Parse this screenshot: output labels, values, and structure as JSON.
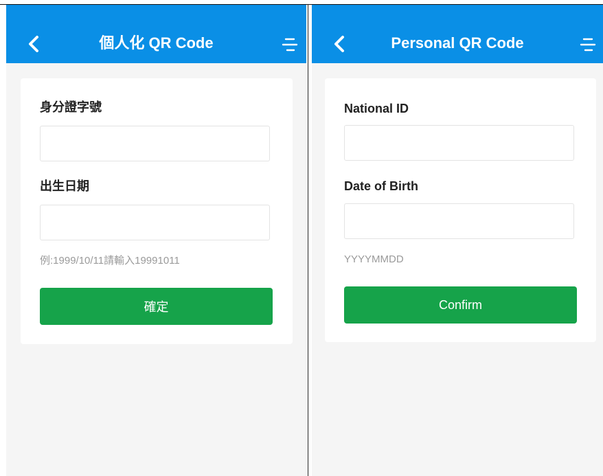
{
  "colors": {
    "header": "#0a8fe6",
    "background": "#f5f5f5",
    "card": "#ffffff",
    "button": "#16a34a",
    "hint": "#9a9a9a"
  },
  "icons": {
    "back": "chevron-left-icon",
    "menu": "menu-icon"
  },
  "left_screen": {
    "title": "個人化 QR Code",
    "id_label": "身分證字號",
    "id_value": "",
    "dob_label": "出生日期",
    "dob_value": "",
    "dob_hint": "例:1999/10/11請輸入19991011",
    "confirm_label": "確定"
  },
  "right_screen": {
    "title": "Personal QR Code",
    "id_label": "National ID",
    "id_value": "",
    "dob_label": "Date of Birth",
    "dob_value": "",
    "dob_hint": "YYYYMMDD",
    "confirm_label": "Confirm"
  }
}
